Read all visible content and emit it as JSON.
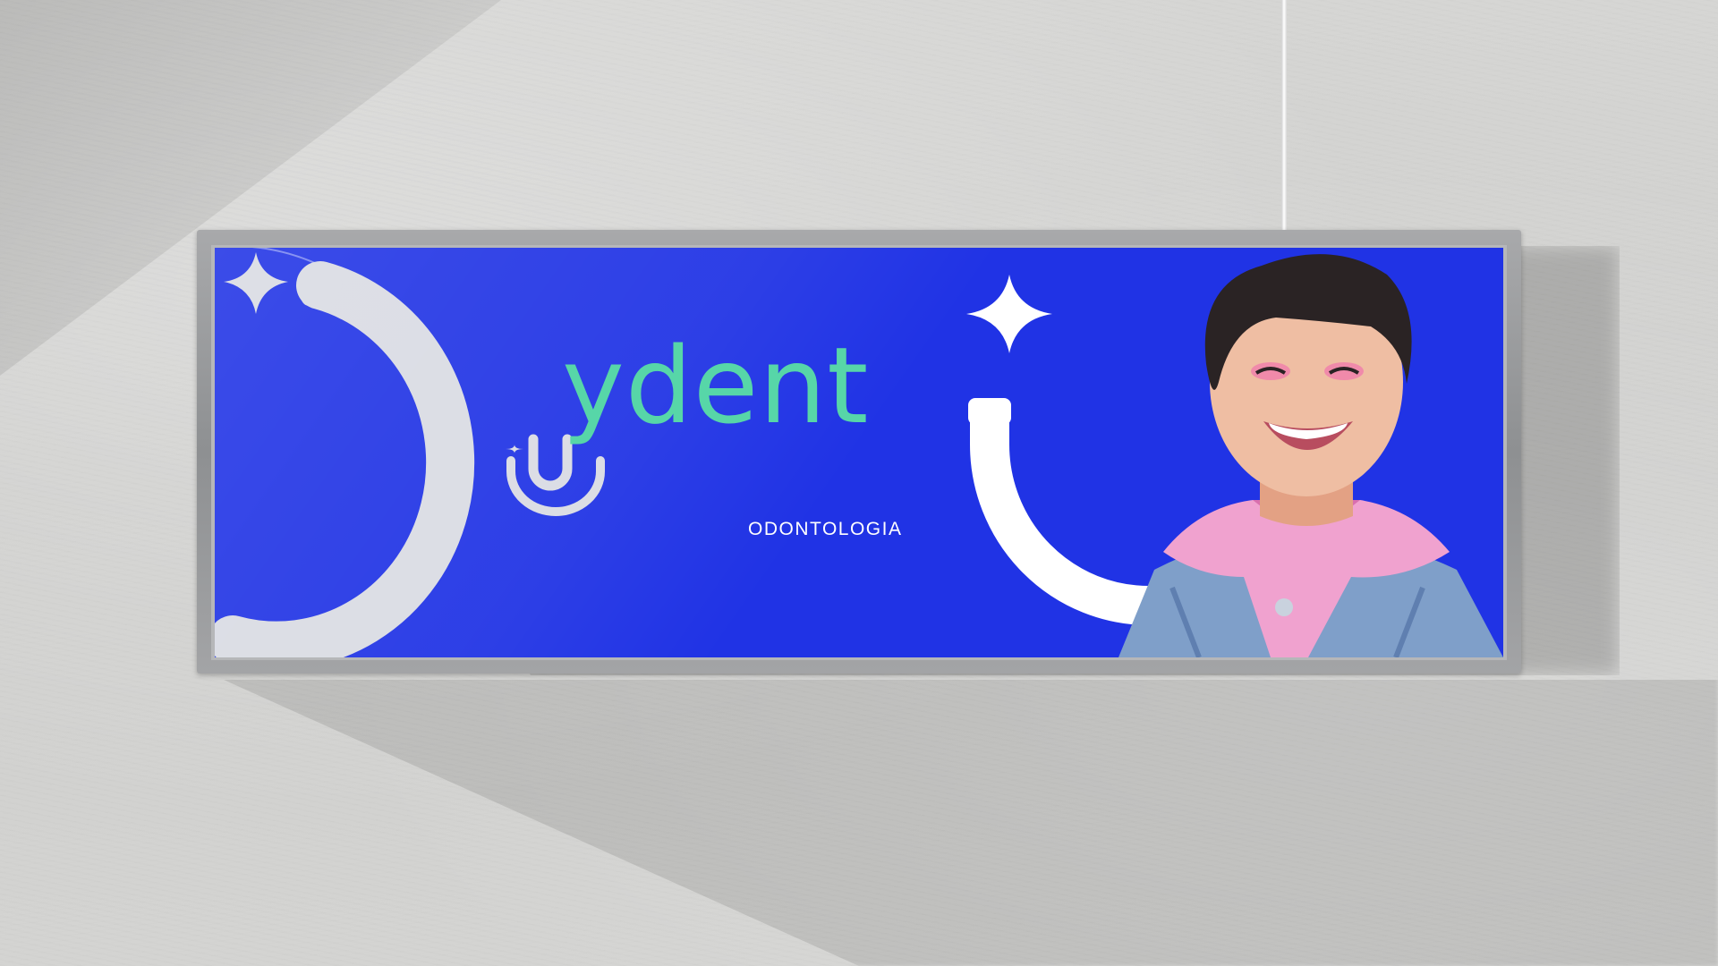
{
  "brand": {
    "name": "ydent",
    "tagline": "ODONTOLOGIA",
    "colors": {
      "primary_blue": "#2033e5",
      "mint_green": "#57d6a8",
      "light_gray": "#d9dbe3",
      "pink": "#f0a2cf",
      "denim": "#7f9fc9"
    }
  },
  "scene": {
    "wall": "concrete wall",
    "sign": "wall-mounted billboard",
    "icons": [
      "sparkle-icon",
      "arc-icon",
      "smile-arc-icon"
    ]
  }
}
